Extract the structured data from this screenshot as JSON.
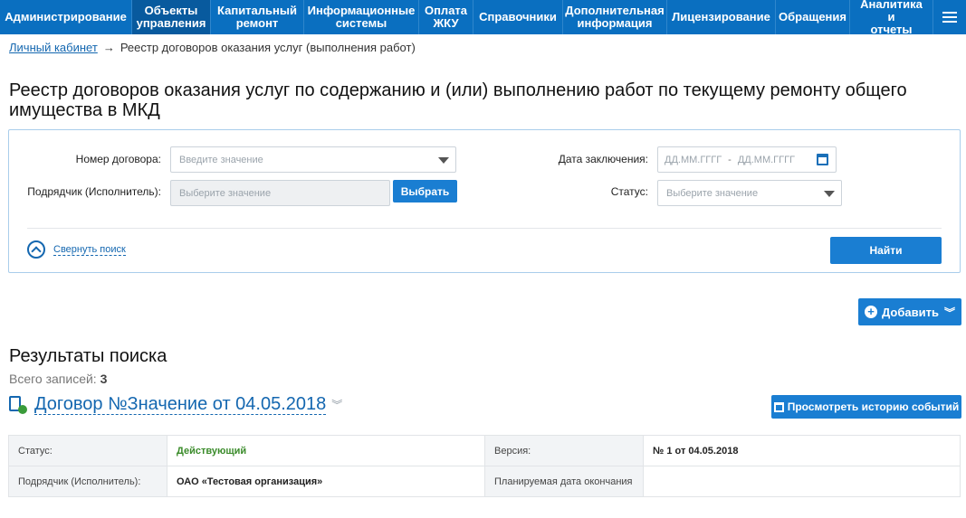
{
  "nav": {
    "items": [
      {
        "label": "Администрирование"
      },
      {
        "label": "Объекты\nуправления"
      },
      {
        "label": "Капитальный\nремонт"
      },
      {
        "label": "Информационные\nсистемы"
      },
      {
        "label": "Оплата\nЖКУ"
      },
      {
        "label": "Справочники"
      },
      {
        "label": "Дополнительная\nинформация"
      },
      {
        "label": "Лицензирование"
      },
      {
        "label": "Обращения"
      },
      {
        "label": "Аналитика и\nотчеты"
      }
    ]
  },
  "breadcrumb": {
    "home": "Личный кабинет",
    "arrow": "→",
    "current": "Реестр договоров оказания услуг (выполнения работ)"
  },
  "page_title": "Реестр договоров оказания услуг по содержанию и (или) выполнению работ по текущему ремонту общего имущества в МКД",
  "search": {
    "contract_number_label": "Номер договора:",
    "contract_number_placeholder": "Введите значение",
    "contractor_label": "Подрядчик (Исполнитель):",
    "contractor_placeholder": "Выберите значение",
    "select_button": "Выбрать",
    "date_label": "Дата заключения:",
    "date_from_placeholder": "ДД.ММ.ГГГГ",
    "date_separator": "-",
    "date_to_placeholder": "ДД.ММ.ГГГГ",
    "status_label": "Статус:",
    "status_placeholder": "Выберите значение",
    "collapse_label": "Свернуть поиск",
    "find_button": "Найти"
  },
  "actions": {
    "add_button": "Добавить"
  },
  "results": {
    "title": "Результаты поиска",
    "total_label": "Всего записей:",
    "total_count": "3",
    "contract_title": "Договор №Значение от 04.05.2018",
    "history_button": "Просмотреть историю событий",
    "details": {
      "status_label": "Статус:",
      "status_value": "Действующий",
      "version_label": "Версия:",
      "version_value": "№ 1 от 04.05.2018",
      "contractor_label": "Подрядчик (Исполнитель):",
      "contractor_value": "ОАО «Тестовая организация»",
      "planned_end_label": "Планируемая дата окончания",
      "planned_end_value": ""
    }
  },
  "colors": {
    "nav_bg": "#0a6fc0",
    "button_blue": "#1a7ed2",
    "link_blue": "#1467b0",
    "status_green": "#3a8b2a"
  }
}
